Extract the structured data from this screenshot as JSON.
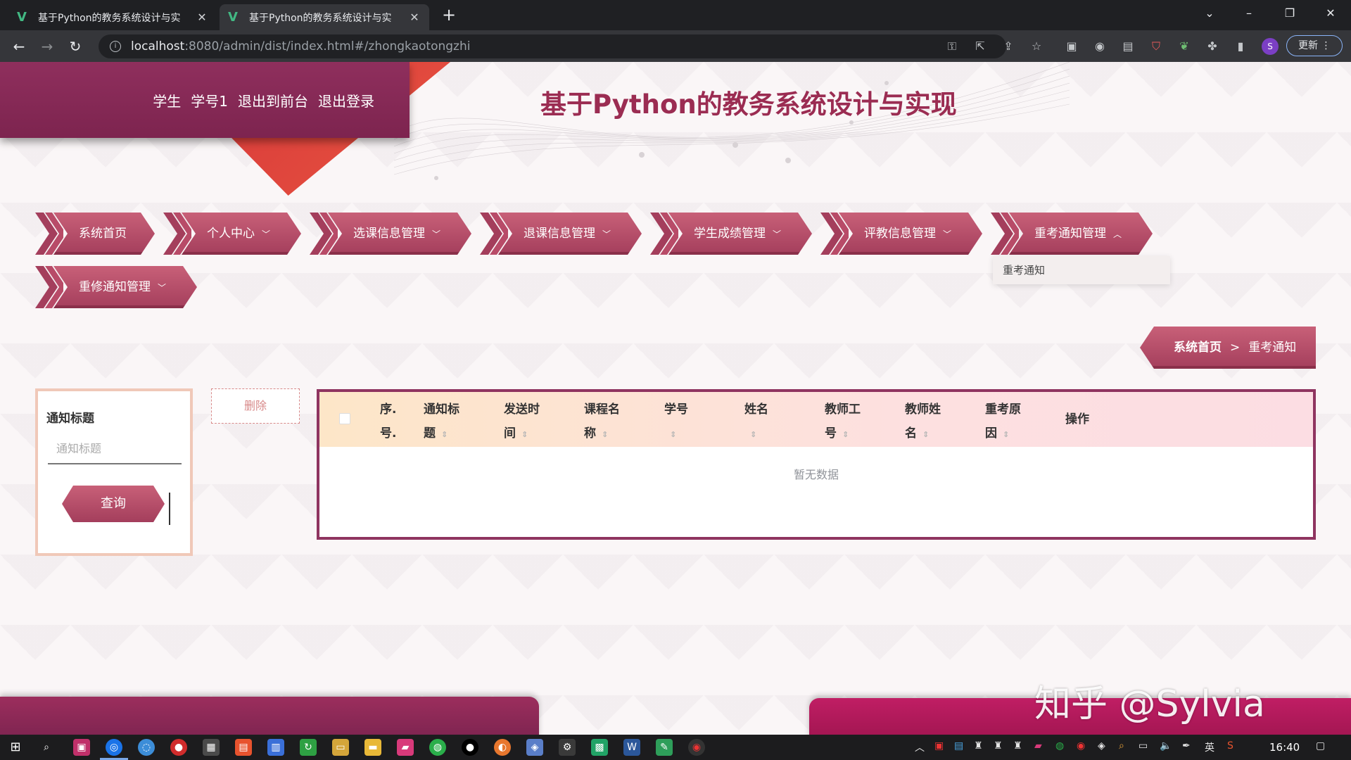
{
  "browser": {
    "tabs": [
      {
        "title": "基于Python的教务系统设计与实",
        "active": false
      },
      {
        "title": "基于Python的教务系统设计与实",
        "active": true
      }
    ],
    "url_host": "localhost",
    "url_path": ":8080/admin/dist/index.html#/zhongkaotongzhi",
    "update_label": "更新",
    "profile_initial": "S"
  },
  "header": {
    "user_role": "学生",
    "user_name": "学号1",
    "to_front_label": "退出到前台",
    "logout_label": "退出登录",
    "site_title": "基于Python的教务系统设计与实现"
  },
  "nav": {
    "items": [
      {
        "label": "系统首页",
        "has_caret": false
      },
      {
        "label": "个人中心",
        "has_caret": true
      },
      {
        "label": "选课信息管理",
        "has_caret": true
      },
      {
        "label": "退课信息管理",
        "has_caret": true
      },
      {
        "label": "学生成绩管理",
        "has_caret": true
      },
      {
        "label": "评教信息管理",
        "has_caret": true
      },
      {
        "label": "重考通知管理",
        "has_caret": true,
        "expanded": true
      },
      {
        "label": "重修通知管理",
        "has_caret": true
      }
    ],
    "dropdown_item": "重考通知"
  },
  "breadcrumb": {
    "home": "系统首页",
    "separator": ">",
    "current": "重考通知"
  },
  "search": {
    "field_label": "通知标题",
    "placeholder": "通知标题",
    "query_button": "查询"
  },
  "actions": {
    "delete_label": "删除"
  },
  "table": {
    "columns": [
      {
        "line1": "序.",
        "line2": "号."
      },
      {
        "line1": "通知标",
        "line2": "题"
      },
      {
        "line1": "发送时",
        "line2": "间"
      },
      {
        "line1": "课程名",
        "line2": "称"
      },
      {
        "line1": "学号",
        "line2": ""
      },
      {
        "line1": "姓名",
        "line2": ""
      },
      {
        "line1": "教师工",
        "line2": "号"
      },
      {
        "line1": "教师姓",
        "line2": "名"
      },
      {
        "line1": "重考原",
        "line2": "因"
      },
      {
        "line1": "操作",
        "line2": ""
      }
    ],
    "empty_text": "暂无数据"
  },
  "watermark": "知乎 @Sylvia",
  "taskbar": {
    "ime": "英",
    "clock": "16:40"
  },
  "colors": {
    "primary": "#a43e5c",
    "header_dark": "#7d244f",
    "title": "#9b2c52",
    "accent_red": "#d83a3a"
  }
}
